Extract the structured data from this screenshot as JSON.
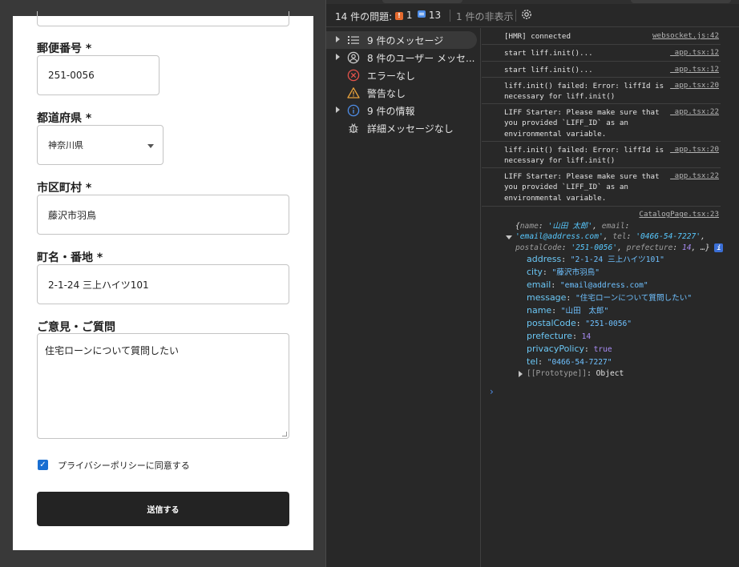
{
  "form": {
    "postal_code": {
      "label": "郵便番号 *",
      "value": "251-0056"
    },
    "prefecture": {
      "label": "都道府県 *",
      "value": "神奈川県"
    },
    "city": {
      "label": "市区町村 *",
      "value": "藤沢市羽鳥"
    },
    "address": {
      "label": "町名・番地 *",
      "value": "2-1-24 三上ハイツ101"
    },
    "message": {
      "label": "ご意見・ご質問",
      "value": "住宅ローンについて質問したい"
    },
    "privacy_label": "プライバシーポリシーに同意する",
    "privacy_checked": true,
    "submit_label": "送信する"
  },
  "issues_bar": {
    "title": "14 件の問題:",
    "warning_count": "1",
    "info_count": "13",
    "hidden": "1 件の非表示"
  },
  "sidebar": {
    "items": [
      {
        "label": "9 件のメッセージ",
        "icon": "list-icon"
      },
      {
        "label": "8 件のユーザー メッセ...",
        "icon": "user-icon"
      },
      {
        "label": "エラーなし",
        "icon": "error-icon"
      },
      {
        "label": "警告なし",
        "icon": "warning-icon"
      },
      {
        "label": "9 件の情報",
        "icon": "info-icon"
      },
      {
        "label": "詳細メッセージなし",
        "icon": "bug-icon"
      }
    ]
  },
  "console": {
    "logs": [
      {
        "text": "[HMR] connected",
        "source": "websocket.js:42"
      },
      {
        "text": "start liff.init()...",
        "source": "_app.tsx:12"
      },
      {
        "text": "start liff.init()...",
        "source": "_app.tsx:12"
      },
      {
        "text": "liff.init() failed: Error: liffId is necessary for liff.init()",
        "source": "_app.tsx:20"
      },
      {
        "text": "LIFF Starter: Please make sure that you provided `LIFF_ID` as an environmental variable.",
        "source": "_app.tsx:22"
      },
      {
        "text": "liff.init() failed: Error: liffId is necessary for liff.init()",
        "source": "_app.tsx:20"
      },
      {
        "text": "LIFF Starter: Please make sure that you provided `LIFF_ID` as an environmental variable.",
        "source": "_app.tsx:22"
      }
    ],
    "object_log": {
      "source": "CatalogPage.tsx:23",
      "preview": {
        "k_name": "name",
        "v_name": "'山田 太郎'",
        "k_email": "email",
        "v_email": "'email@address.com'",
        "k_tel": "tel",
        "v_tel": "'0466-54-7227'",
        "k_postal": "postalCode",
        "v_postal": "'251-0056'",
        "k_pref_a": "p",
        "k_pref_b": "refecture",
        "v_pref": "14",
        "ellipsis": "…}"
      },
      "properties": [
        {
          "key": "address",
          "value": "\"2-1-24 三上ハイツ101\"",
          "type": "string"
        },
        {
          "key": "city",
          "value": "\"藤沢市羽鳥\"",
          "type": "string"
        },
        {
          "key": "email",
          "value": "\"email@address.com\"",
          "type": "string"
        },
        {
          "key": "message",
          "value": "\"住宅ローンについて質問したい\"",
          "type": "string"
        },
        {
          "key": "name",
          "value": "\"山田　太郎\"",
          "type": "string"
        },
        {
          "key": "postalCode",
          "value": "\"251-0056\"",
          "type": "string"
        },
        {
          "key": "prefecture",
          "value": "14",
          "type": "number"
        },
        {
          "key": "privacyPolicy",
          "value": "true",
          "type": "boolean"
        },
        {
          "key": "tel",
          "value": "\"0466-54-7227\"",
          "type": "string"
        }
      ],
      "prototype_key": "[[Prototype]]",
      "prototype_value": "Object"
    },
    "prompt_symbol": "›"
  }
}
